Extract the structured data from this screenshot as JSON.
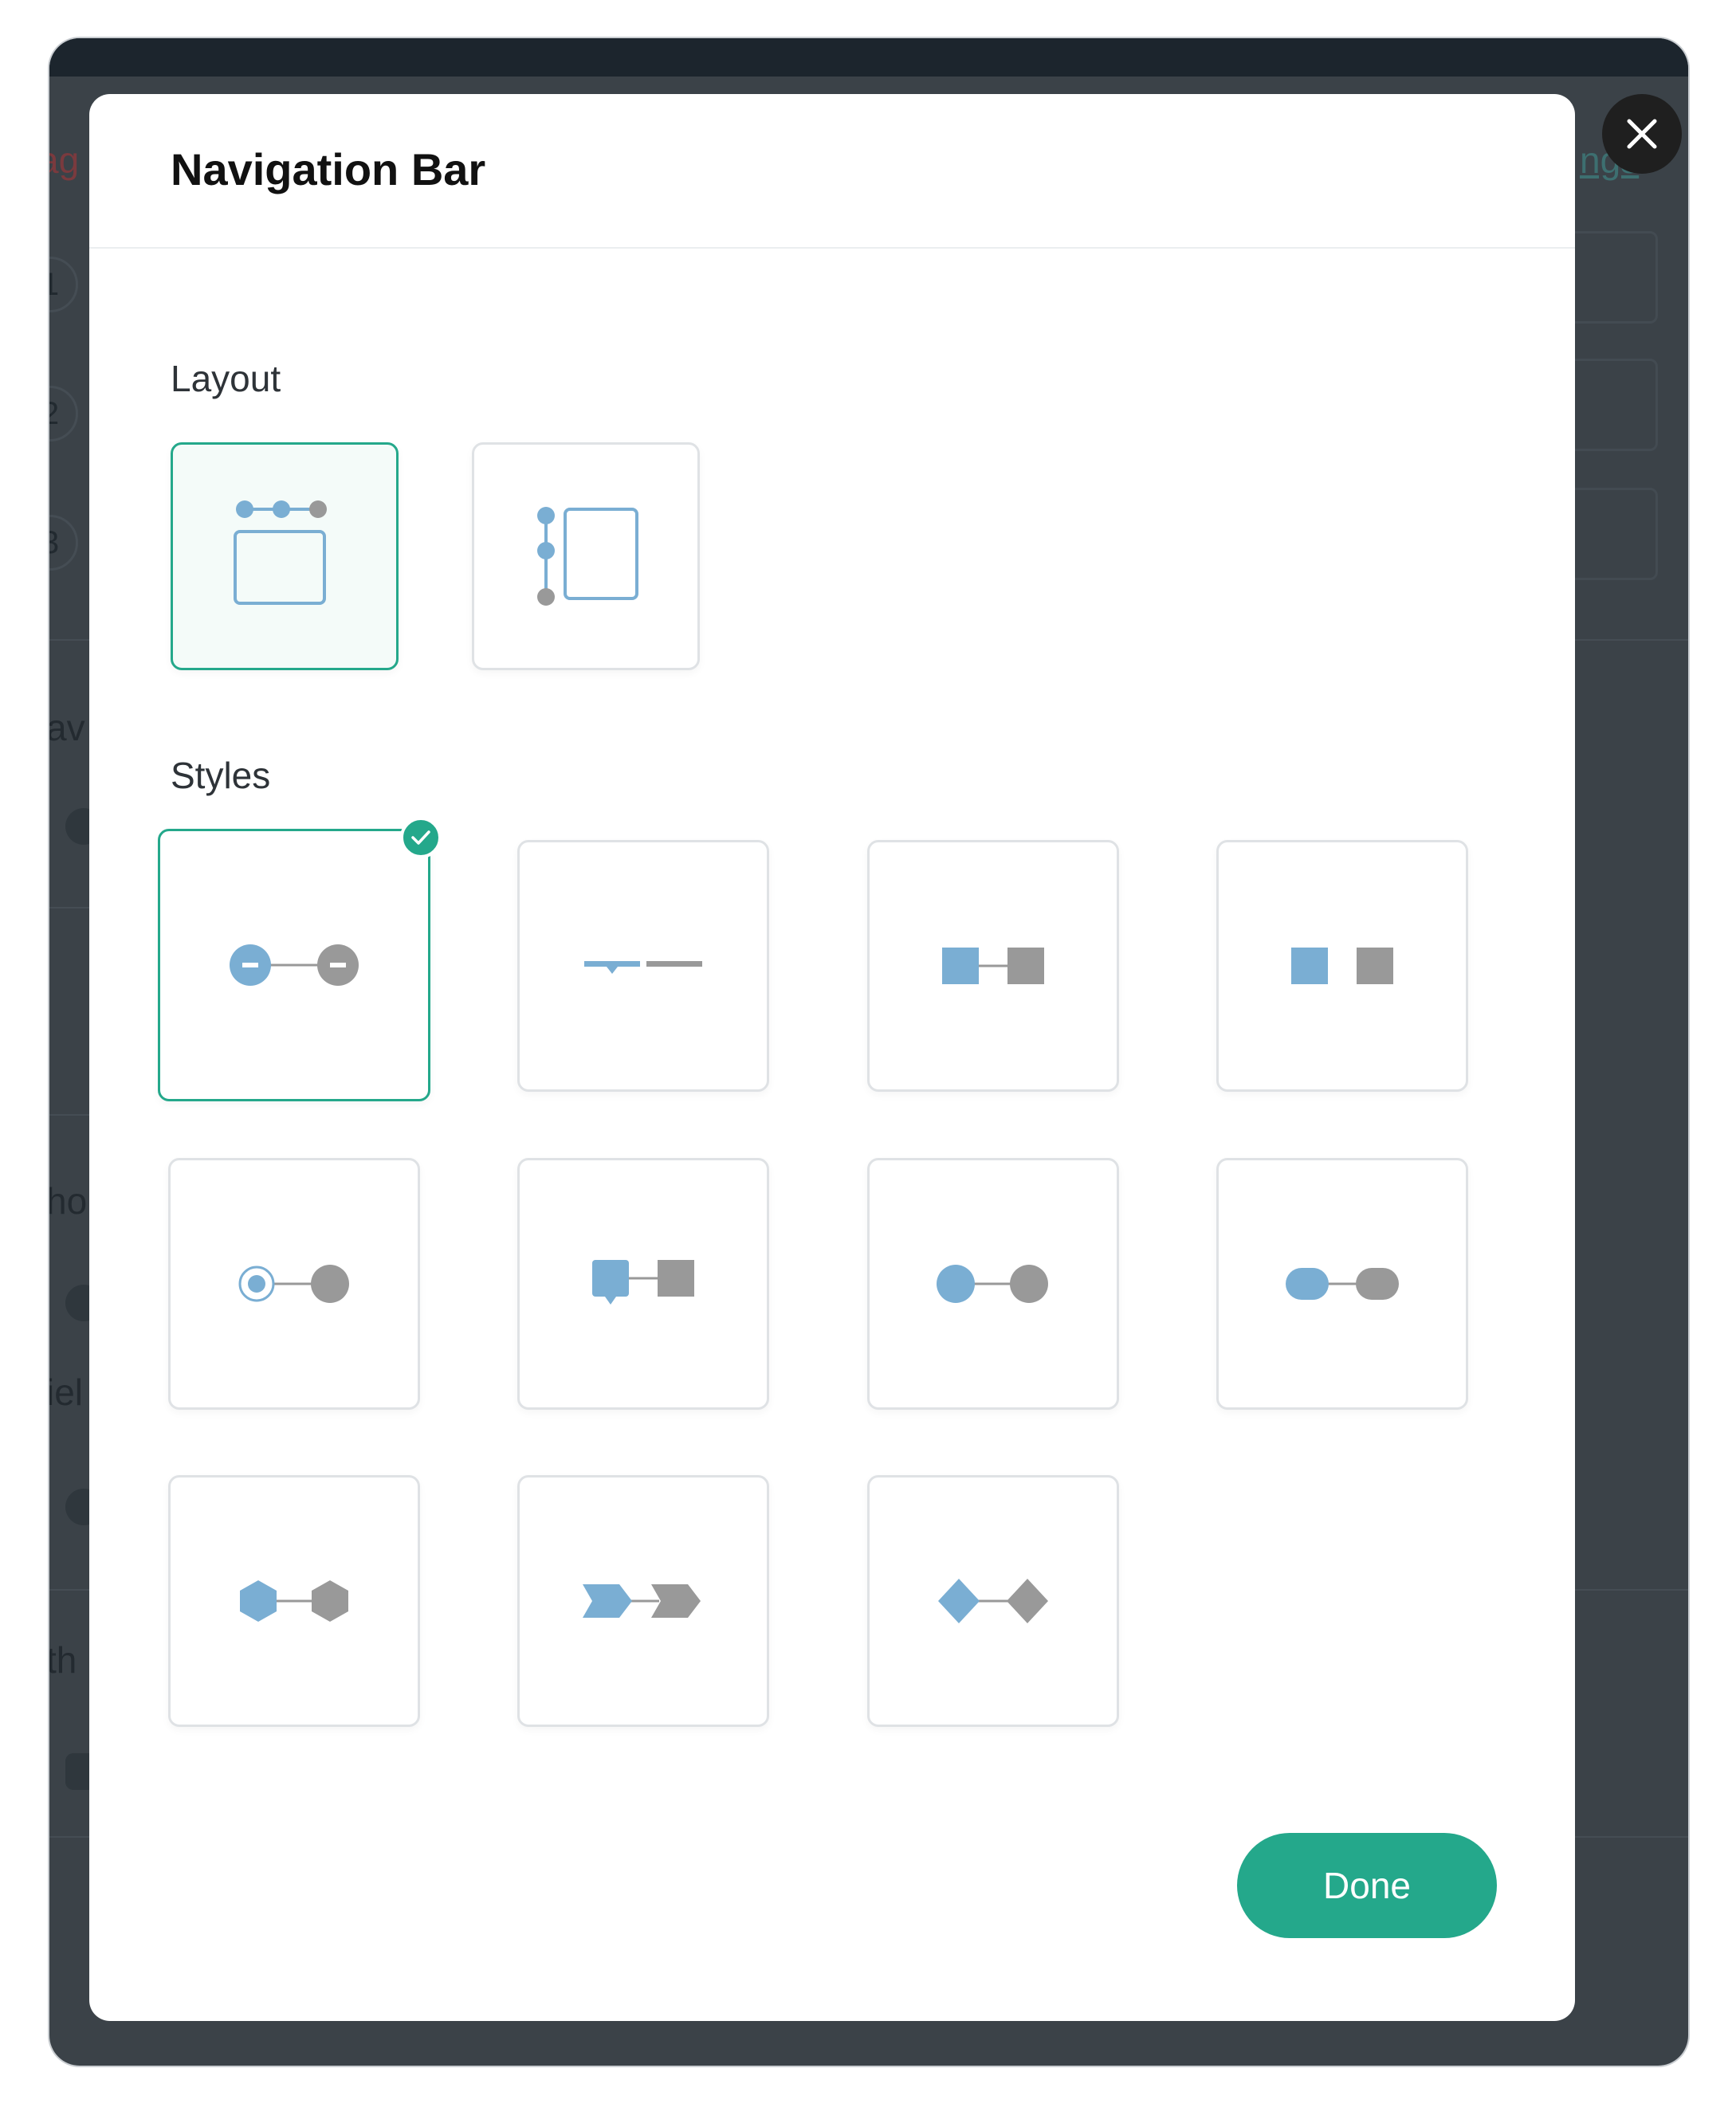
{
  "background": {
    "fragments": [
      "ag",
      "ngs",
      "av",
      "ho",
      "iel",
      "th"
    ],
    "step_numbers": [
      "1",
      "2",
      "3"
    ]
  },
  "modal": {
    "title": "Navigation Bar",
    "layout_label": "Layout",
    "styles_label": "Styles",
    "done_label": "Done",
    "selected_layout": "top",
    "selected_style": "circle-minus"
  },
  "layouts": [
    {
      "name": "top-layout",
      "selected": true
    },
    {
      "name": "side-layout",
      "selected": false
    }
  ],
  "styles": [
    {
      "name": "circle-minus",
      "selected": true
    },
    {
      "name": "line-pointer",
      "selected": false
    },
    {
      "name": "square-connected",
      "selected": false
    },
    {
      "name": "square-separate",
      "selected": false
    },
    {
      "name": "radio-circle",
      "selected": false
    },
    {
      "name": "square-pointer",
      "selected": false
    },
    {
      "name": "circle-connected",
      "selected": false
    },
    {
      "name": "pill-connected",
      "selected": false
    },
    {
      "name": "hexagon",
      "selected": false
    },
    {
      "name": "chevron-arrow",
      "selected": false
    },
    {
      "name": "diamond",
      "selected": false
    }
  ],
  "icons": {
    "close": "close-icon",
    "check": "check-icon"
  },
  "colors": {
    "accent": "#24a88b",
    "active_step": "#7aaed3",
    "inactive_step": "#999999",
    "backdrop": "#3b4248"
  }
}
